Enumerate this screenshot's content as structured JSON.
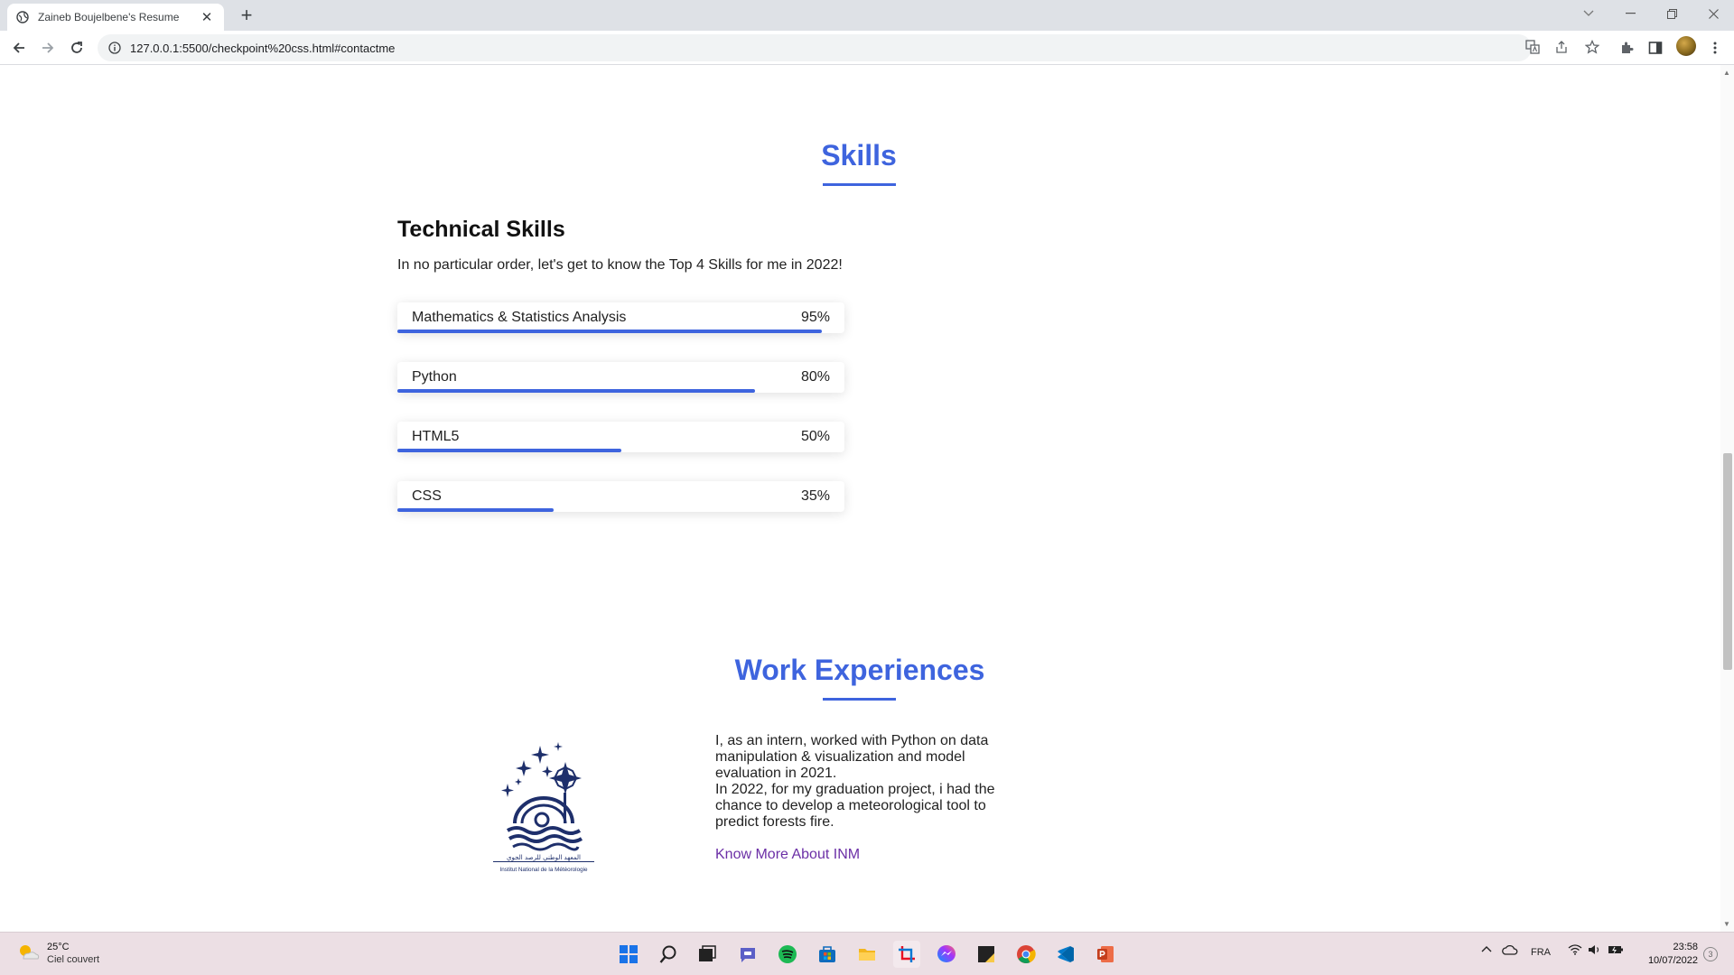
{
  "browser": {
    "tab_title": "Zaineb Boujelbene's Resume",
    "tab_close": "✕",
    "new_tab": "+",
    "url": "127.0.0.1:5500/checkpoint%20css.html#contactme"
  },
  "skills": {
    "title": "Skills",
    "subtitle": "Technical Skills",
    "intro": "In no particular order, let's get to know the Top 4 Skills for me in 2022!",
    "items": [
      {
        "name": "Mathematics & Statistics Analysis",
        "percent_label": "95%",
        "level": 0.95
      },
      {
        "name": "Python",
        "percent_label": "80%",
        "level": 0.8
      },
      {
        "name": "HTML5",
        "percent_label": "50%",
        "level": 0.5
      },
      {
        "name": "CSS",
        "percent_label": "35%",
        "level": 0.35
      }
    ]
  },
  "work": {
    "title": "Work Experiences",
    "line1": "I, as an intern, worked with Python on data manipulation & visualization and model evaluation in 2021.",
    "line2": "In 2022, for my graduation project, i had the chance to develop a meteorological tool to predict forests fire.",
    "link": "Know More About INM",
    "logo_caption_ar": "المعهد الوطني للرصد الجوي",
    "logo_caption_fr": "Institut National de la Météorologie"
  },
  "taskbar": {
    "temperature": "25°C",
    "condition": "Ciel couvert",
    "language": "FRA",
    "time": "23:58",
    "date": "10/07/2022",
    "notifications": "3"
  },
  "colors": {
    "accent": "#3e64de",
    "link": "#6b2fa6"
  }
}
